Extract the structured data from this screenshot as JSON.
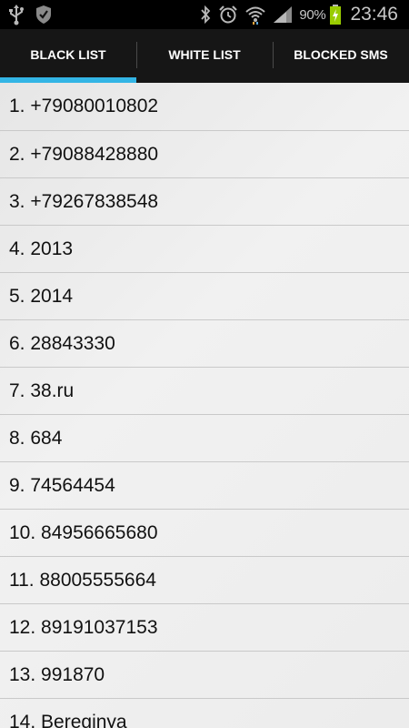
{
  "status_bar": {
    "battery_percent": "90%",
    "time": "23:46"
  },
  "tabs": [
    {
      "label": "BLACK LIST",
      "active": true
    },
    {
      "label": "WHITE LIST",
      "active": false
    },
    {
      "label": "BLOCKED SMS",
      "active": false
    }
  ],
  "accent_color": "#33b5e5",
  "list_items": [
    "1. +79080010802",
    "2. +79088428880",
    "3. +79267838548",
    "4. 2013",
    "5. 2014",
    "6. 28843330",
    "7. 38.ru",
    "8. 684",
    "9. 74564454",
    "10. 84956665680",
    "11. 88005555664",
    "12. 89191037153",
    "13. 991870",
    "14. Bereginya"
  ]
}
